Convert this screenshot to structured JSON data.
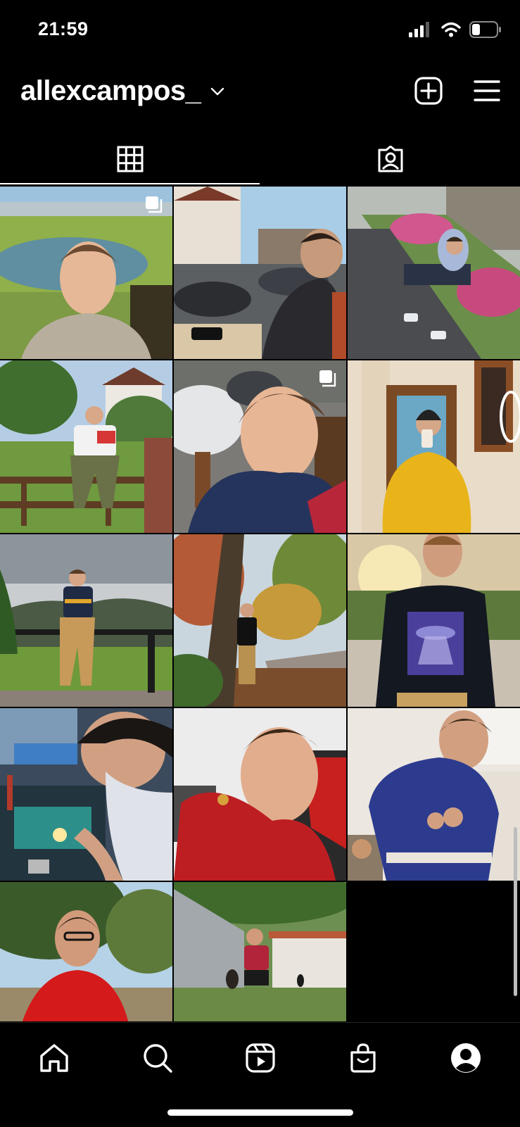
{
  "status_bar": {
    "time": "21:59",
    "icons": [
      "cellular-signal-icon",
      "wifi-icon",
      "battery-icon"
    ]
  },
  "header": {
    "username": "allexcampos_",
    "icons": [
      "chevron-down-icon",
      "new-post-icon",
      "menu-icon"
    ]
  },
  "tabs": [
    {
      "name": "posts-grid",
      "icon": "grid-icon",
      "selected": true
    },
    {
      "name": "tagged",
      "icon": "tagged-person-icon",
      "selected": false
    }
  ],
  "posts": [
    {
      "subject": "selfie by lake",
      "carousel": true
    },
    {
      "subject": "sitting at street cafe",
      "carousel": false
    },
    {
      "subject": "sitting on curb with flowers",
      "carousel": false
    },
    {
      "subject": "sitting on wooden fence",
      "carousel": false
    },
    {
      "subject": "selfie in blue hoodie",
      "carousel": true
    },
    {
      "subject": "mirror selfie yellow jacket",
      "carousel": false
    },
    {
      "subject": "sitting on railing, mountain view",
      "carousel": false
    },
    {
      "subject": "standing by tree, autumn road",
      "carousel": false
    },
    {
      "subject": "sunset, graphic t-shirt",
      "carousel": false
    },
    {
      "subject": "repairing electronics",
      "carousel": false
    },
    {
      "subject": "selfie in red jersey",
      "carousel": false
    },
    {
      "subject": "tying blue gi belt",
      "carousel": false
    },
    {
      "subject": "red shirt under tree",
      "carousel": false
    },
    {
      "subject": "crouching with dog",
      "carousel": false
    }
  ],
  "bottom_nav": [
    {
      "name": "home",
      "icon": "home-icon"
    },
    {
      "name": "search",
      "icon": "search-icon"
    },
    {
      "name": "reels",
      "icon": "reels-icon"
    },
    {
      "name": "shop",
      "icon": "shop-bag-icon"
    },
    {
      "name": "profile",
      "icon": "profile-icon"
    }
  ],
  "colors": {
    "background": "#000000",
    "foreground": "#ffffff",
    "divider": "#262626"
  }
}
